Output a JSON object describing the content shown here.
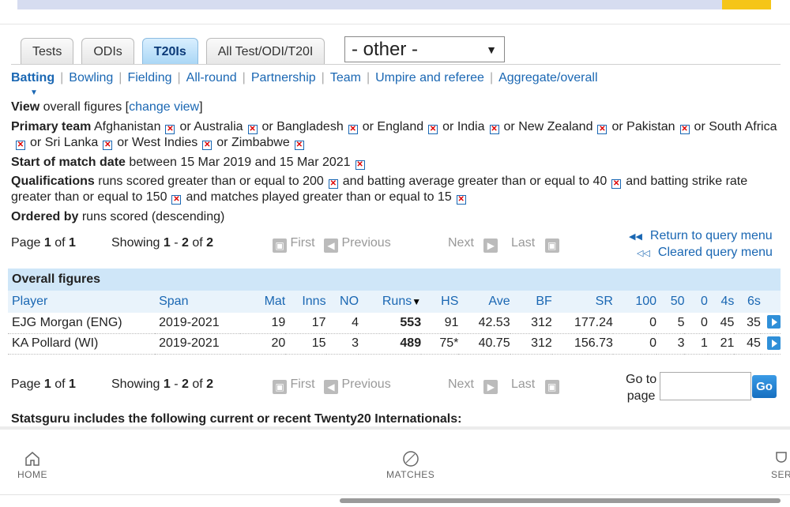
{
  "tabs": [
    {
      "label": "Tests",
      "active": false
    },
    {
      "label": "ODIs",
      "active": false
    },
    {
      "label": "T20Is",
      "active": true
    },
    {
      "label": "All Test/ODI/T20I",
      "active": false
    }
  ],
  "select": {
    "value": "- other -"
  },
  "subnav": [
    "Batting",
    "Bowling",
    "Fielding",
    "All-round",
    "Partnership",
    "Team",
    "Umpire and referee",
    "Aggregate/overall"
  ],
  "query": {
    "view_label": "View",
    "view_text": "overall figures",
    "change_view": "change view",
    "primary_label": "Primary team",
    "teams": [
      "Afghanistan",
      "Australia",
      "Bangladesh",
      "England",
      "India",
      "New Zealand",
      "Pakistan",
      "South Africa",
      "Sri Lanka",
      "West Indies",
      "Zimbabwe"
    ],
    "or": "or",
    "date_label": "Start of match date",
    "date_text": "between 15 Mar 2019 and 15 Mar 2021",
    "qual_label": "Qualifications",
    "qual_1": "runs scored greater than or equal to 200",
    "and": "and",
    "qual_2": "batting average greater than or equal to 40",
    "qual_3a": "batting strike",
    "qual_3b": "rate greater than or equal to 150",
    "qual_4": "matches played greater than or equal to 15",
    "ordered_label": "Ordered by",
    "ordered_text": "runs scored (descending)"
  },
  "pager": {
    "page_label": "Page",
    "page": "1",
    "of": "of",
    "total_pages": "1",
    "showing_label": "Showing",
    "from": "1",
    "dash": "-",
    "to": "2",
    "total": "2",
    "first": "First",
    "previous": "Previous",
    "next": "Next",
    "last": "Last"
  },
  "links": {
    "return_query": "Return to query menu",
    "cleared_query": "Cleared query menu"
  },
  "table": {
    "caption": "Overall figures",
    "columns": [
      "Player",
      "Span",
      "Mat",
      "Inns",
      "NO",
      "Runs",
      "HS",
      "Ave",
      "BF",
      "SR",
      "100",
      "50",
      "0",
      "4s",
      "6s"
    ],
    "rows": [
      [
        "EJG Morgan (ENG)",
        "2019-2021",
        "19",
        "17",
        "4",
        "553",
        "91",
        "42.53",
        "312",
        "177.24",
        "0",
        "5",
        "0",
        "45",
        "35"
      ],
      [
        "KA Pollard (WI)",
        "2019-2021",
        "20",
        "15",
        "3",
        "489",
        "75*",
        "40.75",
        "312",
        "156.73",
        "0",
        "3",
        "1",
        "21",
        "45"
      ]
    ]
  },
  "goto": {
    "line1": "Go to",
    "line2": "page",
    "button": "Go"
  },
  "stats_line": "Statsguru includes the following current or recent Twenty20 Internationals:",
  "bottom_nav": {
    "home": "HOME",
    "matches": "MATCHES",
    "series": "SER"
  }
}
